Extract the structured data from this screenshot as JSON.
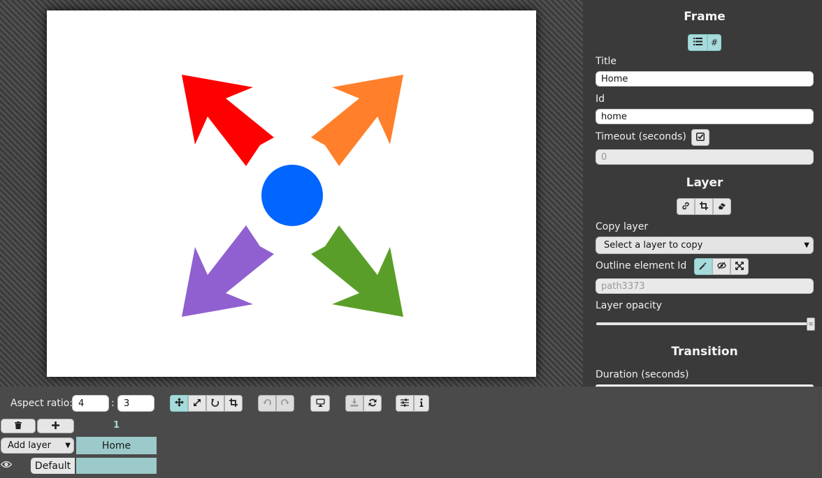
{
  "panel": {
    "frame_title": "Frame",
    "title_label": "Title",
    "title_value": "Home",
    "id_label": "Id",
    "id_value": "home",
    "timeout_label": "Timeout (seconds)",
    "timeout_placeholder": "0",
    "layer_title": "Layer",
    "copy_layer_label": "Copy layer",
    "copy_layer_selected": "Select a layer to copy",
    "outline_label": "Outline element Id",
    "outline_placeholder": "path3373",
    "opacity_label": "Layer opacity",
    "opacity_value": 1.0,
    "transition_title": "Transition",
    "duration_label": "Duration (seconds)"
  },
  "toolbar": {
    "aspect_label": "Aspect ratio:",
    "aspect_w": "4",
    "aspect_sep": ":",
    "aspect_h": "3"
  },
  "timeline": {
    "frame_number": "1",
    "add_layer_label": "Add layer",
    "frame_name": "Home",
    "layer_name": "Default"
  },
  "colors": {
    "red_arrow": "#ff0000",
    "orange_arrow": "#ff7f2a",
    "purple_arrow": "#9060d0",
    "green_arrow": "#5a9e2a",
    "circle": "#0066ff",
    "accent": "#a7dadb"
  }
}
